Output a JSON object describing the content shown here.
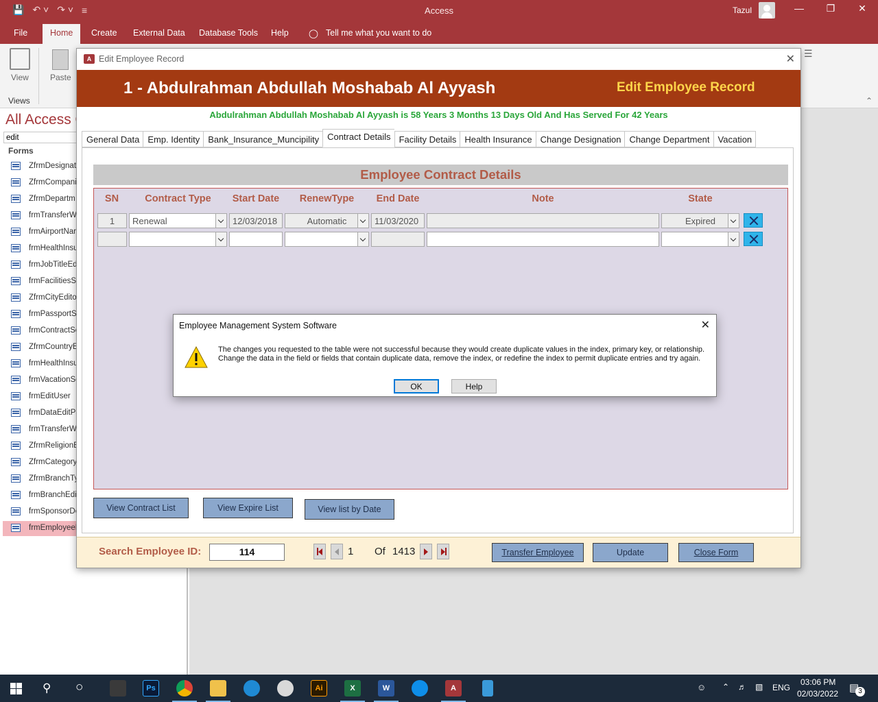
{
  "window": {
    "app_title": "Access",
    "user": "Tazul"
  },
  "ribbon": {
    "tabs": [
      "File",
      "Home",
      "Create",
      "External Data",
      "Database Tools",
      "Help"
    ],
    "tell_me": "Tell me what you want to do",
    "view_label": "View",
    "paste_label": "Paste",
    "views_group": "Views"
  },
  "nav": {
    "title": "All Access O",
    "search_value": "edit",
    "section": "Forms",
    "items": [
      "ZfrmDesignat",
      "ZfrmCompani",
      "ZfrmDepartm",
      "frmTransferW",
      "frmAirportNar",
      "frmHealthInsu",
      "frmJobTitleEd",
      "frmFacilitiesSe",
      "ZfrmCityEdito",
      "frmPassportSe",
      "frmContractSe",
      "ZfrmCountryE",
      "frmHealthInsu",
      "frmVacationSe",
      "frmEditUser",
      "frmDataEditPa",
      "frmTransferW",
      "ZfrmReligionE",
      "ZfrmCategory",
      "ZfrmBranchTy",
      "frmBranchEdit",
      "frmSponsorDe",
      "frmEmployeeE"
    ],
    "selected_index": 22
  },
  "form": {
    "window_title": "Edit Employee Record",
    "employee_name": "1 - Abdulrahman Abdullah Moshabab Al Ayyash",
    "form_title": "Edit Employee Record",
    "age_service_line": "Abdulrahman Abdullah Moshabab Al Ayyash is 58 Years 3 Months 13 Days Old And Has Served For 42 Years",
    "tabs": [
      "General Data",
      "Emp. Identity",
      "Bank_Insurance_Muncipility",
      "Contract Details",
      "Facility Details",
      "Health Insurance",
      "Change Designation",
      "Change Department",
      "Vacation"
    ],
    "active_tab": "Contract Details",
    "section_heading": "Employee Contract Details",
    "columns": [
      "SN",
      "Contract Type",
      "Start Date",
      "RenewType",
      "End Date",
      "Note",
      "State"
    ],
    "rows": [
      {
        "sn": "1",
        "contract_type": "Renewal",
        "start_date": "12/03/2018",
        "renew_type": "Automatic",
        "end_date": "11/03/2020",
        "note": "",
        "state": "Expired"
      },
      {
        "sn": "",
        "contract_type": "",
        "start_date": "",
        "renew_type": "",
        "end_date": "",
        "note": "",
        "state": ""
      }
    ],
    "buttons": {
      "view_contract_list": "View Contract List",
      "view_expire_list": "View Expire List",
      "view_list_by_date": "View list by Date"
    },
    "footer": {
      "search_label": "Search Employee ID:",
      "search_value": "114",
      "record_current": "1",
      "record_of": "Of",
      "record_total": "1413",
      "transfer_button": "Transfer Employee",
      "update_button": "Update",
      "close_button": "Close Form"
    }
  },
  "dialog": {
    "title": "Employee Management System Software",
    "message": "The changes you requested to the table were not successful because they would create duplicate values in the index, primary key, or relationship. Change the data in the field or fields that contain duplicate data, remove the index, or redefine the index to permit duplicate entries and try again.",
    "ok_label": "OK",
    "help_label": "Help"
  },
  "taskbar": {
    "language": "ENG",
    "time": "03:06 PM",
    "date": "02/03/2022",
    "notification_count": "3",
    "apps": [
      "file-explorer-icon",
      "photoshop-icon",
      "chrome-icon",
      "folder-icon",
      "edge-icon",
      "paint-icon",
      "illustrator-icon",
      "excel-icon",
      "word-icon",
      "teamviewer-icon",
      "access-icon",
      "phone-icon"
    ]
  },
  "colors": {
    "access_accent": "#a4373a",
    "form_header": "#a33a12",
    "form_title_yellow": "#ffd54a",
    "age_line_green": "#2aa63a",
    "grid_background": "#ddd8e6",
    "button_blue": "#8ba7cc"
  }
}
